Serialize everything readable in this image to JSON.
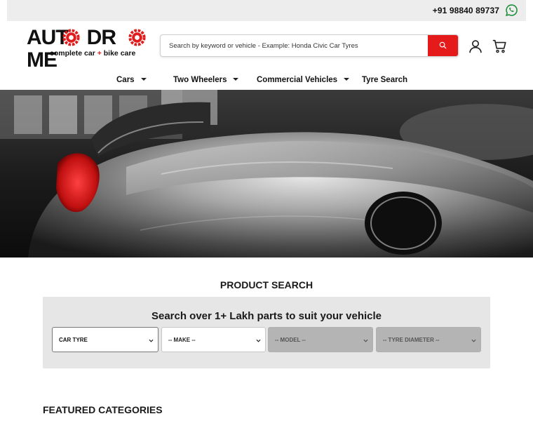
{
  "topbar": {
    "phone": "+91 98840 89737",
    "whatsapp_icon": "whatsapp-icon",
    "background": "#ededed"
  },
  "header": {
    "logo": {
      "word": "AUTODROME",
      "tagline_a": "complete car",
      "tagline_plus": "+",
      "tagline_b": "bike care",
      "accent": "#e01c1c"
    },
    "search": {
      "placeholder": "Search by keyword or vehicle - Example: Honda Civic Car Tyres",
      "button_icon": "search-icon",
      "button_color": "#e51b1b"
    },
    "icons": [
      "user-icon",
      "cart-icon"
    ]
  },
  "nav": {
    "items": [
      {
        "label": "Cars",
        "has_dropdown": true
      },
      {
        "label": "Two Wheelers",
        "has_dropdown": true
      },
      {
        "label": "Commercial Vehicles",
        "has_dropdown": true
      },
      {
        "label": "Tyre Search",
        "has_dropdown": false
      }
    ]
  },
  "product_search": {
    "title": "PRODUCT SEARCH",
    "heading": "Search over 1+ Lakh parts to suit your vehicle",
    "selects": [
      {
        "value": "CAR TYRE",
        "state": "active"
      },
      {
        "value": "-- MAKE --",
        "state": "enabled"
      },
      {
        "value": "-- MODEL --",
        "state": "disabled"
      },
      {
        "value": "-- TYRE DIAMETER --",
        "state": "disabled"
      }
    ]
  },
  "featured": {
    "title": "FEATURED CATEGORIES"
  }
}
